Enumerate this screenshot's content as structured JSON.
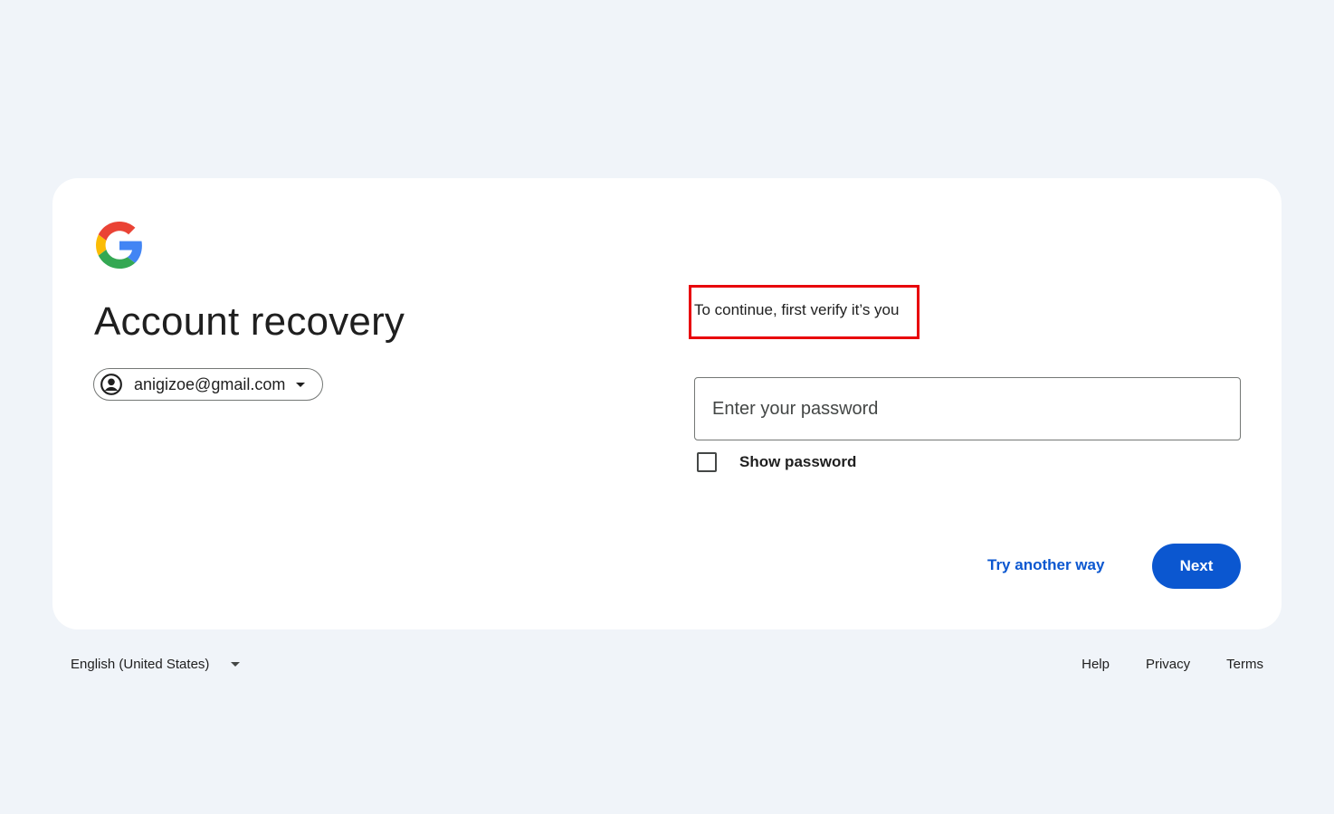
{
  "brand": {
    "logo_icon": "google-g-logo-icon",
    "colors": {
      "blue": "#4285F4",
      "red": "#EA4335",
      "yellow": "#FBBC05",
      "green": "#34A853"
    }
  },
  "page": {
    "title": "Account recovery"
  },
  "account": {
    "email": "anigizoe@gmail.com",
    "avatar_icon": "account-circle-icon",
    "dropdown_icon": "caret-down-icon"
  },
  "verify": {
    "message": "To continue, first verify it’s you",
    "highlight_color": "#e8000b"
  },
  "password": {
    "placeholder": "Enter your password",
    "value": "",
    "show_password_label": "Show password",
    "show_password_checked": false
  },
  "actions": {
    "try_another_way": "Try another way",
    "next": "Next",
    "primary_color": "#0b57d0"
  },
  "footer": {
    "language": "English (United States)",
    "links": {
      "help": "Help",
      "privacy": "Privacy",
      "terms": "Terms"
    }
  }
}
